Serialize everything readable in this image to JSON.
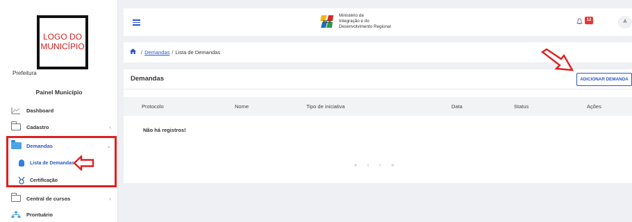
{
  "sidebar": {
    "logo_text": "LOGO DO MUNICÍPIO",
    "prefeitura": "Prefeitura",
    "painel": "Painel Município",
    "items": {
      "dashboard": "Dashboard",
      "cadastro": "Cadastro",
      "demandas": "Demandas",
      "lista": "Lista de Demandas",
      "certificacao": "Certificação",
      "central": "Central de cursos",
      "prontuario": "Prontuário"
    },
    "chevron_collapsed": "‹",
    "chevron_expanded": "⌄"
  },
  "topbar": {
    "org_line1": "Ministério da",
    "org_line2": "Integração e do",
    "org_line3": "Desenvolvimento Regional",
    "midr_logo_text": "MIDR",
    "notification_count": "12",
    "avatar_initial": "A"
  },
  "breadcrumb": {
    "link": "Demandas",
    "current": "Lista de Demandas",
    "separator": "/"
  },
  "main": {
    "title": "Demandas",
    "add_button": "ADICIONAR DEMANDA",
    "columns": [
      "Protocolo",
      "Nome",
      "Tipo de iniciativa",
      "Data",
      "Status",
      "Ações"
    ],
    "empty_message": "Não há registros!",
    "pager": [
      "«",
      "‹",
      "›",
      "»"
    ]
  },
  "colors": {
    "accent": "#2a56c6",
    "highlight": "#e01e1e",
    "badge": "#e53935"
  }
}
